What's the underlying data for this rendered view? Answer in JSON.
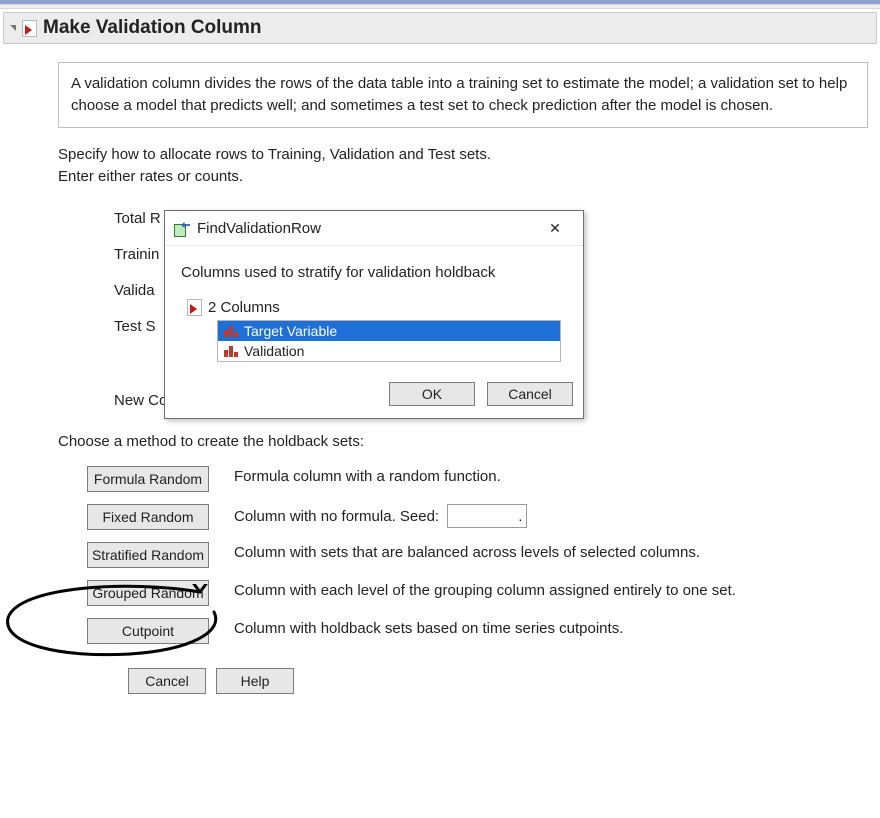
{
  "header": {
    "title": "Make Validation Column"
  },
  "description": "A validation column divides the rows of the data table into a training set to estimate the model; a validation set to help choose a model that predicts well; and sometimes a test set to check prediction after the model is chosen.",
  "instruction1": "Specify how to allocate rows to Training, Validation and Test sets.",
  "instruction2": "Enter either rates or counts.",
  "rows": {
    "total": "Total R",
    "training": "Trainin",
    "validation": "Valida",
    "test": "Test S",
    "newcol": "New Co"
  },
  "methodSection": {
    "title": "Choose a method to create the holdback sets:",
    "methods": [
      {
        "button": "Formula Random",
        "desc": "Formula column with a random function."
      },
      {
        "button": "Fixed Random",
        "desc": "Column with no formula. Seed:"
      },
      {
        "button": "Stratified Random",
        "desc": "Column with sets that are balanced across levels of selected columns."
      },
      {
        "button": "Grouped Random",
        "desc": "Column with each level of the grouping column assigned entirely to one set."
      },
      {
        "button": "Cutpoint",
        "desc": "Column with holdback sets based on time series cutpoints."
      }
    ],
    "seed_value": "."
  },
  "bottom": {
    "cancel": "Cancel",
    "help": "Help"
  },
  "dialog": {
    "title": "FindValidationRow",
    "message": "Columns used to stratify for validation holdback",
    "count_label": "2 Columns",
    "items": [
      "Target Variable",
      "Validation"
    ],
    "ok": "OK",
    "cancel": "Cancel"
  }
}
